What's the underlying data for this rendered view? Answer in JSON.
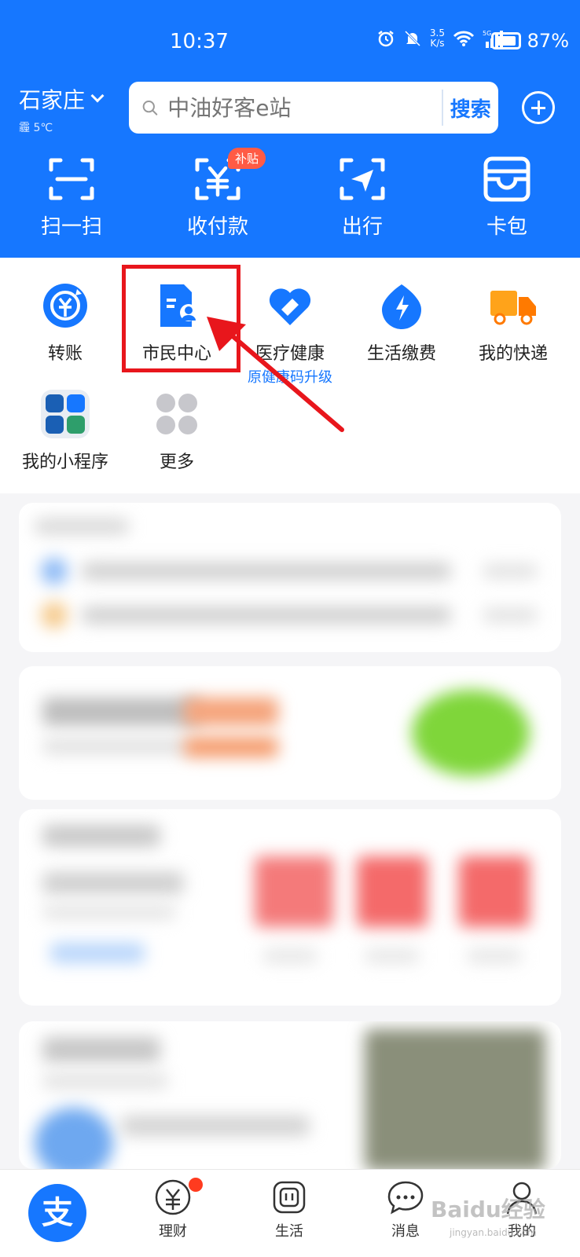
{
  "status_bar": {
    "time": "10:37",
    "net_speed_value": "3.5",
    "net_speed_unit": "K/s",
    "battery": "87%"
  },
  "header": {
    "city": "石家庄",
    "weather": "霾 5℃",
    "search_placeholder": "中油好客e站",
    "search_button": "搜索"
  },
  "quick_actions": [
    {
      "label": "扫一扫",
      "icon": "scan-icon"
    },
    {
      "label": "收付款",
      "icon": "payment-icon",
      "badge": "补贴"
    },
    {
      "label": "出行",
      "icon": "travel-icon"
    },
    {
      "label": "卡包",
      "icon": "wallet-icon"
    }
  ],
  "services": [
    {
      "label": "转账",
      "icon": "transfer-icon",
      "color": "#1677ff"
    },
    {
      "label": "市民中心",
      "icon": "citizen-center-icon",
      "color": "#1677ff"
    },
    {
      "label": "医疗健康",
      "sub": "原健康码升级",
      "icon": "health-heart-icon",
      "color": "#1677ff"
    },
    {
      "label": "生活缴费",
      "icon": "bill-payment-icon",
      "color": "#1677ff"
    },
    {
      "label": "我的快递",
      "icon": "delivery-truck-icon",
      "color": "#ffa31a"
    },
    {
      "label": "我的小程序",
      "icon": "mini-programs-icon"
    },
    {
      "label": "更多",
      "icon": "more-grid-icon"
    }
  ],
  "tabbar": {
    "home_icon": "支",
    "items": [
      "理财",
      "生活",
      "消息",
      "我的"
    ]
  },
  "watermark": {
    "text": "Baidu经验",
    "sub": "jingyan.baidu.com"
  },
  "colors": {
    "brand": "#1677ff",
    "highlight": "#e8161c",
    "badge": "#ff5b45"
  }
}
